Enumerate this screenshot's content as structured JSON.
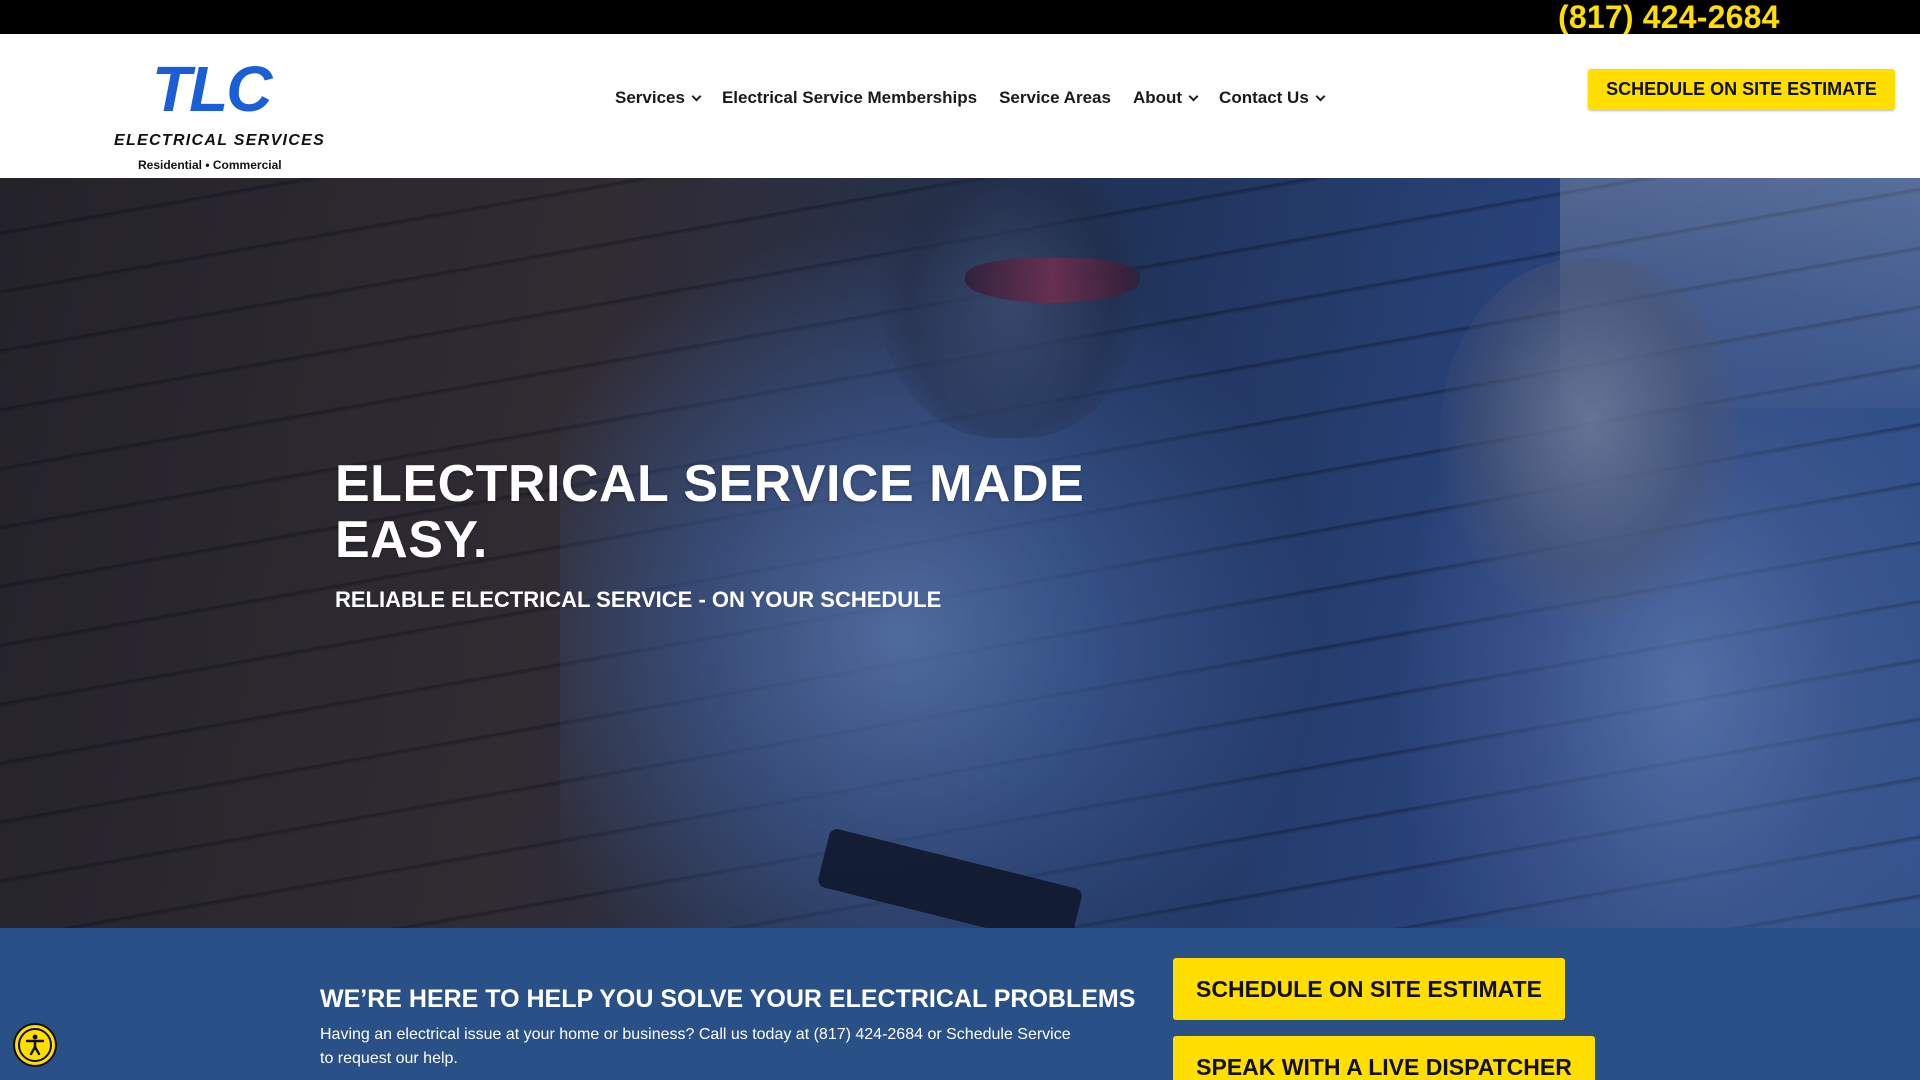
{
  "topbar": {
    "phone": "(817) 424-2684"
  },
  "logo": {
    "brand": "TLC",
    "subtitle": "ELECTRICAL SERVICES",
    "tagline": "Residential • Commercial"
  },
  "nav": {
    "items": [
      {
        "label": "Services",
        "has_dropdown": true
      },
      {
        "label": "Electrical Service Memberships",
        "has_dropdown": false
      },
      {
        "label": "Service Areas",
        "has_dropdown": false
      },
      {
        "label": "About",
        "has_dropdown": true
      },
      {
        "label": "Contact Us",
        "has_dropdown": true
      }
    ]
  },
  "header_cta": {
    "label": "SCHEDULE ON SITE ESTIMATE"
  },
  "hero": {
    "title": "ELECTRICAL SERVICE MADE EASY.",
    "subtitle": "RELIABLE ELECTRICAL SERVICE - ON YOUR SCHEDULE"
  },
  "band": {
    "title": "WE’RE HERE TO HELP YOU SOLVE YOUR ELECTRICAL PROBLEMS",
    "text": "Having an electrical issue at your home or business? Call us today at (817) 424-2684 or Schedule Service to request our help.",
    "primary_button": "SCHEDULE ON SITE ESTIMATE",
    "secondary_button": "SPEAK WITH A LIVE DISPATCHER"
  },
  "accessibility": {
    "icon": "accessibility-icon"
  },
  "colors": {
    "accent": "#ffde00",
    "band": "#2a5088",
    "logo_blue": "#1a5fd6",
    "topbar": "#000000"
  }
}
